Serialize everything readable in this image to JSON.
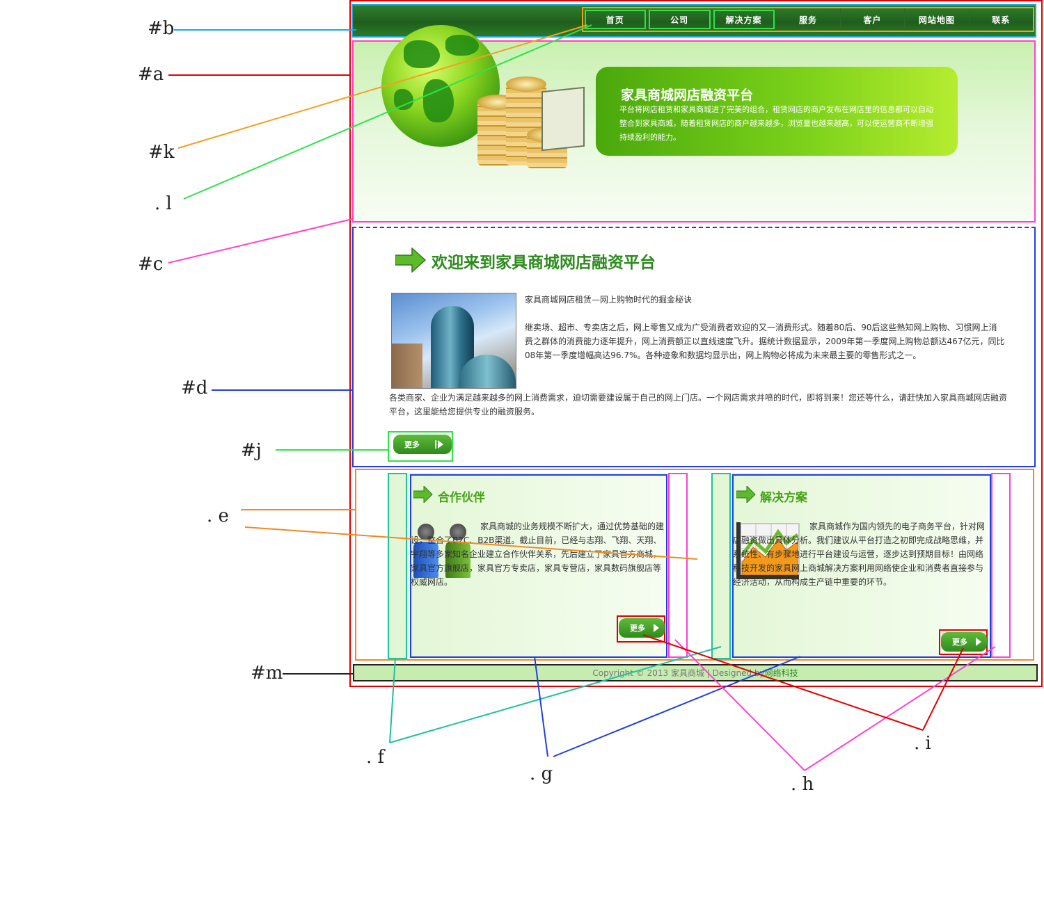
{
  "labels": {
    "b": "#b",
    "a": "#a",
    "k": "#k",
    "l": ". l",
    "c": "#c",
    "d": "#d",
    "j": "#j",
    "e": ". e",
    "m": "#m",
    "f": ". f",
    "g": ". g",
    "h": ". h",
    "i": ". i"
  },
  "nav": [
    "首页",
    "公司",
    "解决方案",
    "服务",
    "客户",
    "网站地图",
    "联系"
  ],
  "banner": {
    "title": "家具商城网店融资平台",
    "text": "平台将网店租赁和家具商城进了完美的组合，租赁网店的商户发布在网店里的信息都可以自动整合到家具商城，随着租赁网店的商户越来越多，浏览量也越来越高，可以使运营商不断增强持续盈利的能力。"
  },
  "welcome": {
    "title": "欢迎来到家具商城网店融资平台",
    "subtitle": "家具商城网店租赁—网上购物时代的掘金秘诀",
    "para1": "继卖场、超市、专卖店之后，网上零售又成为广受消费者欢迎的又一消费形式。随着80后、90后这些熟知网上购物、习惯网上消费之群体的消费能力逐年提升，网上消费额正以直线速度飞升。据统计数据显示，2009年第一季度网上购物总额达467亿元，同比08年第一季度增幅高达96.7%。各种迹象和数据均显示出，网上购物必将成为未来最主要的零售形式之一。",
    "para2": "各类商家、企业为满足越来越多的网上消费需求，迫切需要建设属于自己的网上门店。一个网店需求井喷的时代，即将到来！您还等什么，请赶快加入家具商城网店融资平台，这里能给您提供专业的融资服务。",
    "more": "更多"
  },
  "partner": {
    "title": "合作伙伴",
    "text": "家具商城的业务规模不断扩大，通过优势基础的建设，整合了B2C、B2B渠道。截止目前，已经与志翔、飞翔、天翔、宇翔等多家知名企业建立合作伙伴关系，先后建立了家具官方商城，家具官方旗舰店，家具官方专卖店，家具专营店，家具数码旗舰店等权威网店。",
    "more": "更多"
  },
  "solution": {
    "title": "解决方案",
    "text": "家具商城作为国内领先的电子商务平台，针对网店融资做出具体分析。我们建议从平台打造之初即完成战略思维，并系统性、有步骤地进行平台建设与运营，逐步达到预期目标！由网络科技开发的家具网上商城解决方案利用网络使企业和消费者直接参与经济活动，从而构成生产链中重要的环节。",
    "more": "更多"
  },
  "footer": {
    "copy": "Copyright © 2013 家具商城 | Designed by ",
    "link": "网络科技"
  },
  "colors": {
    "red": "#e10000",
    "blue": "#1f3fe0",
    "cyan": "#1aa8e0",
    "orange": "#f08a20",
    "green": "#2de34a",
    "magenta": "#ff40d0",
    "teal": "#1ec0a0",
    "black": "#222222",
    "brand_green": "#2e8a1f"
  }
}
